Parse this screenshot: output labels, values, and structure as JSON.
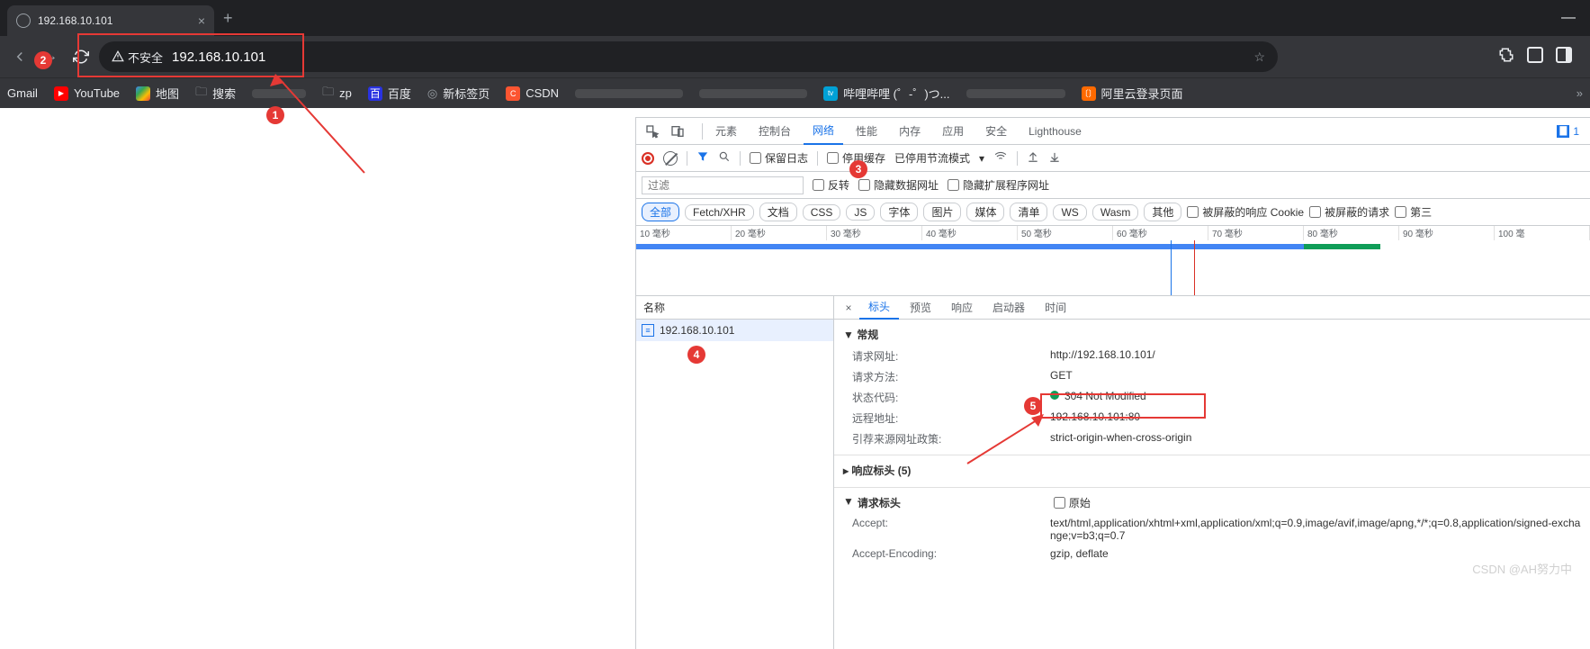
{
  "browser": {
    "tab_title": "192.168.10.101",
    "url": "192.168.10.101",
    "security_label": "不安全"
  },
  "bookmarks": [
    {
      "label": "Gmail"
    },
    {
      "label": "YouTube"
    },
    {
      "label": "地图"
    },
    {
      "label": "搜索"
    },
    {
      "label": "zp"
    },
    {
      "label": "百度"
    },
    {
      "label": "新标签页"
    },
    {
      "label": "CSDN"
    },
    {
      "label": "哔哩哔哩 (゜-゜)つ..."
    },
    {
      "label": "阿里云登录页面"
    }
  ],
  "annotations": {
    "n1": "1",
    "n2": "2",
    "n3": "3",
    "n4": "4",
    "n5": "5"
  },
  "devtools": {
    "tabs": [
      "元素",
      "控制台",
      "网络",
      "性能",
      "内存",
      "应用",
      "安全",
      "Lighthouse"
    ],
    "active_tab": "网络",
    "issues_count": "1",
    "toolbar": {
      "preserve_log": "保留日志",
      "disable_cache": "停用缓存",
      "throttling_status": "已停用节流模式"
    },
    "filter": {
      "placeholder": "过滤",
      "invert": "反转",
      "hide_data": "隐藏数据网址",
      "hide_ext": "隐藏扩展程序网址"
    },
    "types": [
      "全部",
      "Fetch/XHR",
      "文档",
      "CSS",
      "JS",
      "字体",
      "图片",
      "媒体",
      "清单",
      "WS",
      "Wasm",
      "其他"
    ],
    "type_extras": {
      "blocked_cookies": "被屏蔽的响应 Cookie",
      "blocked_requests": "被屏蔽的请求",
      "third_party": "第三"
    },
    "timeline_ticks": [
      "10 毫秒",
      "20 毫秒",
      "30 毫秒",
      "40 毫秒",
      "50 毫秒",
      "60 毫秒",
      "70 毫秒",
      "80 毫秒",
      "90 毫秒",
      "100 毫"
    ],
    "name_col": "名称",
    "request_name": "192.168.10.101",
    "detail_tabs": [
      "标头",
      "预览",
      "响应",
      "启动器",
      "时间"
    ],
    "sections": {
      "general": "常规",
      "response_headers": "响应标头 (5)",
      "request_headers": "请求标头",
      "raw": "原始"
    },
    "general": {
      "url_k": "请求网址:",
      "url_v": "http://192.168.10.101/",
      "method_k": "请求方法:",
      "method_v": "GET",
      "status_k": "状态代码:",
      "status_v": "304 Not Modified",
      "remote_k": "远程地址:",
      "remote_v": "192.168.10.101:80",
      "policy_k": "引荐来源网址政策:",
      "policy_v": "strict-origin-when-cross-origin"
    },
    "req_headers": {
      "accept_k": "Accept:",
      "accept_v": "text/html,application/xhtml+xml,application/xml;q=0.9,image/avif,image/apng,*/*;q=0.8,application/signed-exchange;v=b3;q=0.7",
      "enc_k": "Accept-Encoding:",
      "enc_v": "gzip, deflate"
    }
  },
  "watermark": "CSDN @AH努力中"
}
